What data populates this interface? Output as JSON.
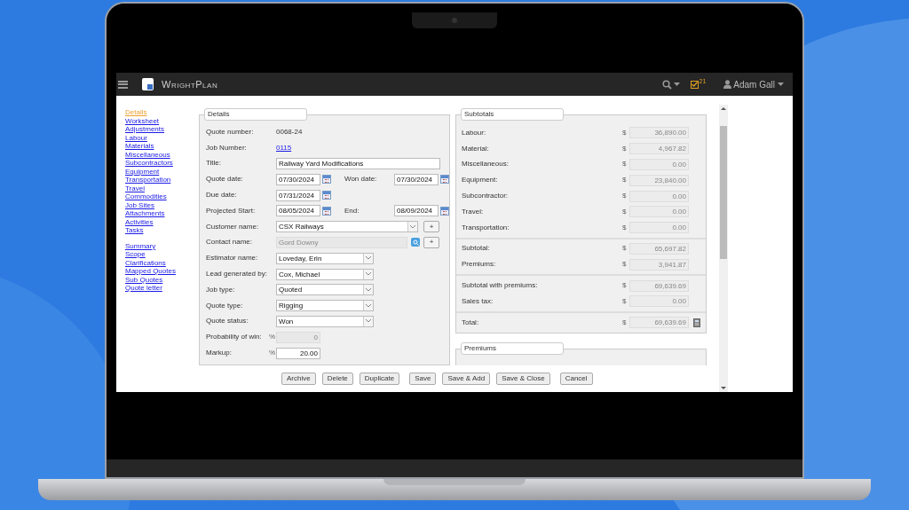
{
  "app": {
    "brand": "WrightPlan",
    "task_count": "21",
    "user": "Adam Gall"
  },
  "sidebar": [
    [
      {
        "label": "Details",
        "selected": true
      },
      {
        "label": "Worksheet",
        "selected": false
      },
      {
        "label": "Adjustments",
        "selected": false
      },
      {
        "label": "Labour",
        "selected": false
      },
      {
        "label": "Materials",
        "selected": false
      },
      {
        "label": "Miscellaneous",
        "selected": false
      },
      {
        "label": "Subcontractors",
        "selected": false
      },
      {
        "label": "Equipment",
        "selected": false
      },
      {
        "label": "Transportation",
        "selected": false
      },
      {
        "label": "Travel",
        "selected": false
      },
      {
        "label": "Commodities",
        "selected": false
      },
      {
        "label": "Job Sites",
        "selected": false
      },
      {
        "label": "Attachments",
        "selected": false
      },
      {
        "label": "Activities",
        "selected": false
      },
      {
        "label": "Tasks",
        "selected": false
      }
    ],
    [
      {
        "label": "Summary",
        "selected": false
      },
      {
        "label": "Scope",
        "selected": false
      },
      {
        "label": "Clarifications",
        "selected": false
      },
      {
        "label": "Mapped Quotes",
        "selected": false
      },
      {
        "label": "Sub Quotes",
        "selected": false
      },
      {
        "label": "Quote letter",
        "selected": false
      }
    ]
  ],
  "details": {
    "legend": "Details",
    "fields": [
      {
        "kind": "text",
        "label": "Quote number:",
        "value": "0068-24"
      },
      {
        "kind": "link",
        "label": "Job Number:",
        "value": "0115"
      },
      {
        "kind": "input",
        "label": "Title:",
        "value": "Railway Yard Modifications"
      },
      {
        "kind": "date",
        "label": "Quote date:",
        "value": "07/30/2024",
        "label2": "Won date:",
        "value2": "07/30/2024"
      },
      {
        "kind": "date",
        "label": "Due date:",
        "value": "07/31/2024"
      },
      {
        "kind": "date",
        "label": "Projected Start:",
        "value": "08/05/2024",
        "label2": "End:",
        "value2": "08/09/2024"
      },
      {
        "kind": "select",
        "label": "Customer name:",
        "value": "CSX Railways",
        "wide": true,
        "add": "+"
      },
      {
        "kind": "lookup",
        "label": "Contact name:",
        "value": "Gord Downy",
        "add": "+"
      },
      {
        "kind": "select",
        "label": "Estimator name:",
        "value": "Loveday, Erin",
        "wide": false
      },
      {
        "kind": "select",
        "label": "Lead generated by:",
        "value": "Cox, Michael",
        "wide": false
      },
      {
        "kind": "select",
        "label": "Job type:",
        "value": "Quoted",
        "wide": false
      },
      {
        "kind": "select",
        "label": "Quote type:",
        "value": "Rigging",
        "wide": false
      },
      {
        "kind": "select",
        "label": "Quote status:",
        "value": "Won",
        "wide": false
      },
      {
        "kind": "percent",
        "label": "Probability of win:",
        "unit": "%",
        "value": "0",
        "disabled": true
      },
      {
        "kind": "percent",
        "label": "Markup:",
        "unit": "%",
        "value": "20.00",
        "disabled": false
      }
    ]
  },
  "subtotals": {
    "legend": "Subtotals",
    "groups": [
      [
        {
          "label": "Labour:",
          "currency": "$",
          "value": "36,890.00"
        },
        {
          "label": "Material:",
          "currency": "$",
          "value": "4,967.82"
        },
        {
          "label": "Miscellaneous:",
          "currency": "$",
          "value": "0.00"
        },
        {
          "label": "Equipment:",
          "currency": "$",
          "value": "23,840.00"
        },
        {
          "label": "Subcontractor:",
          "currency": "$",
          "value": "0.00"
        },
        {
          "label": "Travel:",
          "currency": "$",
          "value": "0.00"
        },
        {
          "label": "Transportation:",
          "currency": "$",
          "value": "0.00"
        }
      ],
      [
        {
          "label": "Subtotal:",
          "currency": "$",
          "value": "65,697.82"
        },
        {
          "label": "Premiums:",
          "currency": "$",
          "value": "3,941.87"
        }
      ],
      [
        {
          "label": "Subtotal with premiums:",
          "currency": "$",
          "value": "69,639.69"
        },
        {
          "label": "Sales tax:",
          "currency": "$",
          "value": "0.00"
        }
      ],
      [
        {
          "label": "Total:",
          "currency": "$",
          "value": "69,639.69",
          "calculator": true
        }
      ]
    ]
  },
  "premiums": {
    "legend": "Premiums"
  },
  "buttons": [
    "Archive",
    "Delete",
    "Duplicate",
    "Save",
    "Save & Add",
    "Save & Close",
    "Cancel"
  ]
}
